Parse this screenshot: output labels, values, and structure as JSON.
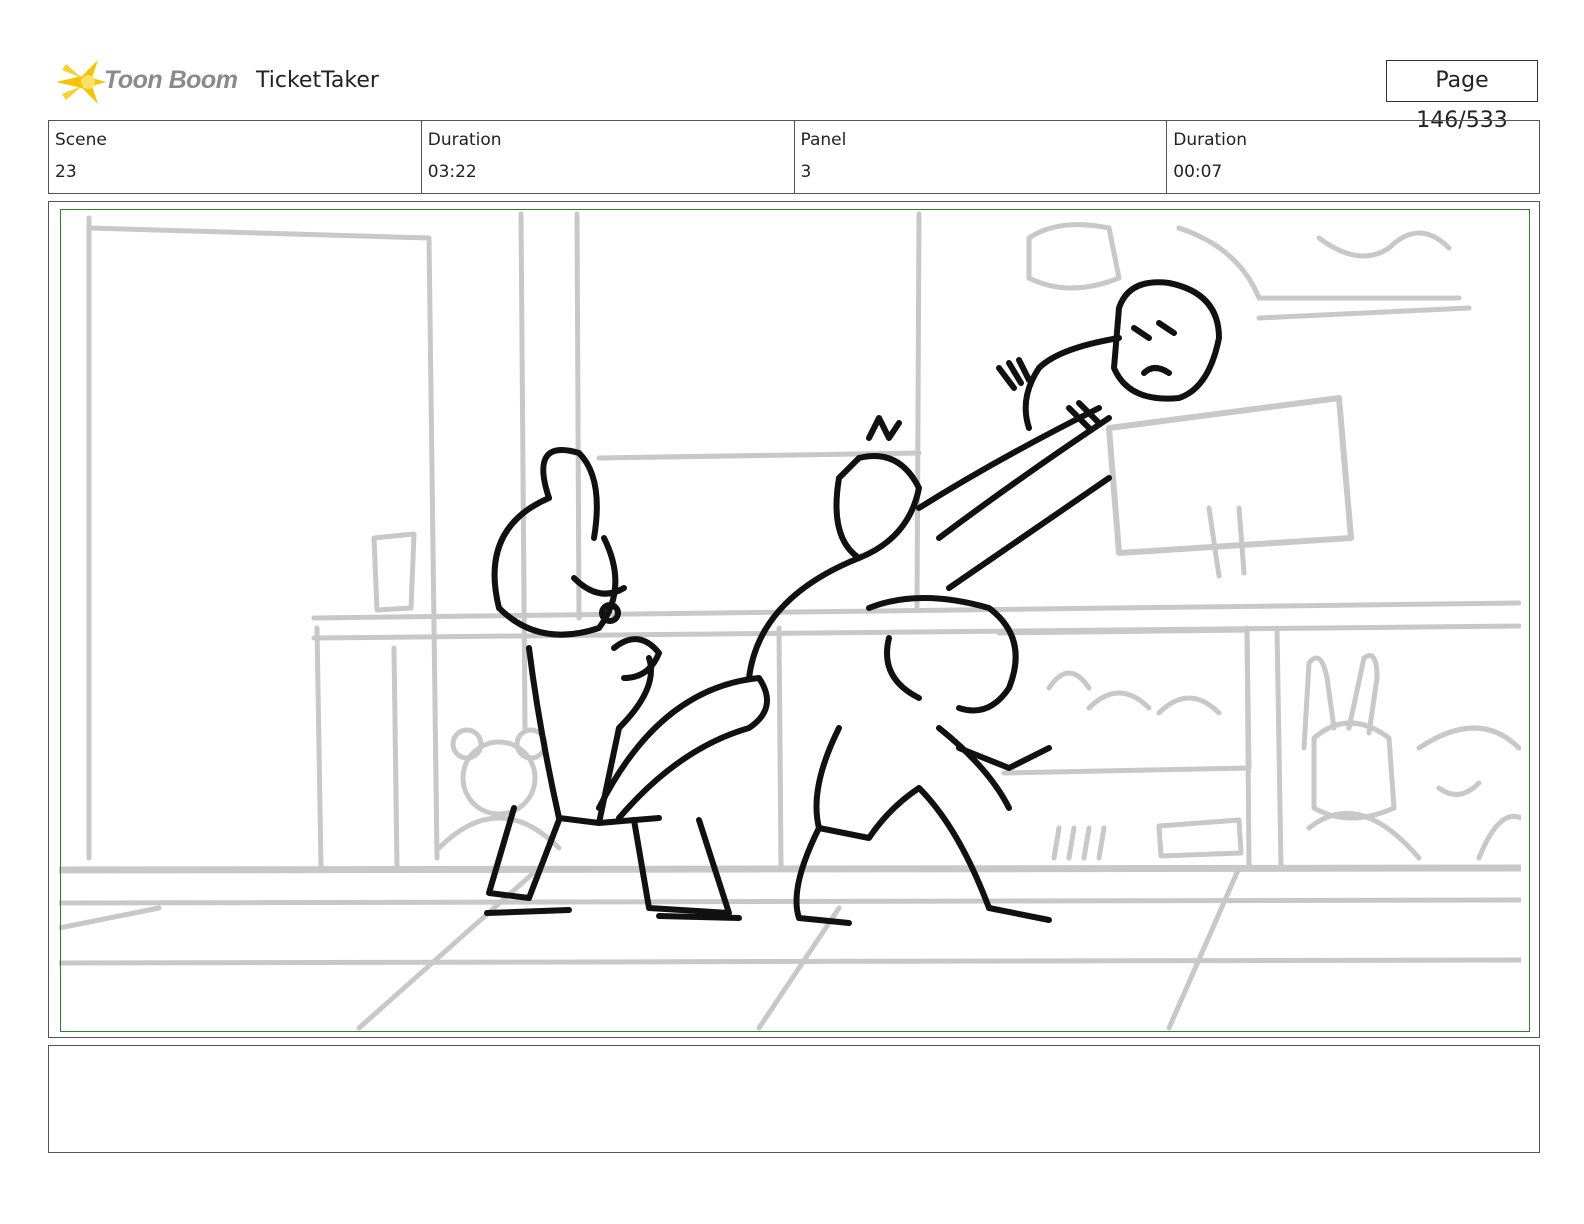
{
  "header": {
    "logo_text": "Toon Boom",
    "project_title": "TicketTaker",
    "page": "Page 146/533"
  },
  "info": {
    "scene_label": "Scene",
    "scene_value": "23",
    "scene_duration_label": "Duration",
    "scene_duration_value": "03:22",
    "panel_label": "Panel",
    "panel_value": "3",
    "panel_duration_label": "Duration",
    "panel_duration_value": "00:07"
  },
  "colors": {
    "safe_area": "#2e7d32",
    "logo_star": "#f5c400",
    "background_sketch": "#c8c8c8",
    "character_ink": "#111111"
  },
  "panel": {
    "description_icon": "storyboard-sketch"
  },
  "notes": {
    "text": ""
  }
}
